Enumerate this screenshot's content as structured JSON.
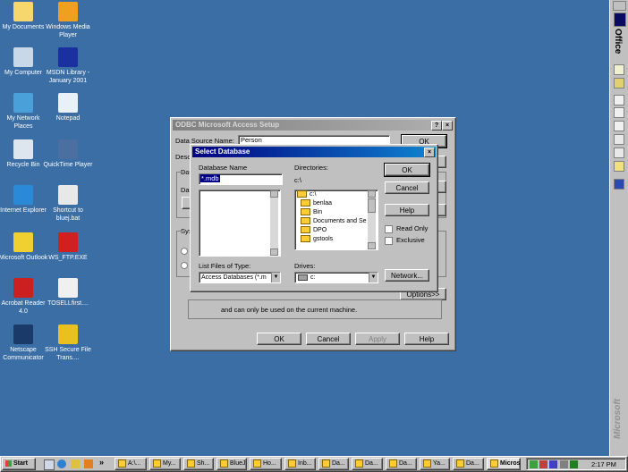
{
  "desktop_icons": [
    {
      "label": "My Documents",
      "icon": "folder-documents-icon",
      "color": "#f5d76e"
    },
    {
      "label": "Windows Media Player",
      "icon": "media-player-icon",
      "color": "#f0a020"
    },
    {
      "label": "My Computer",
      "icon": "computer-icon",
      "color": "#c8d8e8"
    },
    {
      "label": "MSDN Library - January 2001",
      "icon": "msdn-icon",
      "color": "#1a2fa0"
    },
    {
      "label": "My Network Places",
      "icon": "network-icon",
      "color": "#4aa0d8"
    },
    {
      "label": "Notepad",
      "icon": "notepad-icon",
      "color": "#e8f0f8"
    },
    {
      "label": "Recycle Bin",
      "icon": "recycle-bin-icon",
      "color": "#dde6ef"
    },
    {
      "label": "QuickTime Player",
      "icon": "quicktime-icon",
      "color": "#4a6fa0"
    },
    {
      "label": "Internet Explorer",
      "icon": "internet-explorer-icon",
      "color": "#2a8ad8"
    },
    {
      "label": "Shortcut to bluej.bat",
      "icon": "bat-shortcut-icon",
      "color": "#e8e8e8"
    },
    {
      "label": "Microsoft Outlook",
      "icon": "outlook-icon",
      "color": "#f0d030"
    },
    {
      "label": "WS_FTP.EXE",
      "icon": "ftp-icon",
      "color": "#d02020"
    },
    {
      "label": "Acrobat Reader 4.0",
      "icon": "acrobat-icon",
      "color": "#cc2020"
    },
    {
      "label": "TOSELLfirst....",
      "icon": "text-file-icon",
      "color": "#f0f0f0"
    },
    {
      "label": "Netscape Communicator",
      "icon": "netscape-icon",
      "color": "#1a3a6a"
    },
    {
      "label": "SSH Secure File Trans....",
      "icon": "ssh-icon",
      "color": "#e8c020"
    }
  ],
  "odbc": {
    "title": "ODBC Microsoft Access Setup",
    "help_btn": "?",
    "close_btn": "×",
    "dsn_label": "Data Source Name:",
    "dsn_value": "Person",
    "desc_label": "Desc",
    "db_label": "Dat",
    "db_label2": "Dat",
    "sys_label": "Syst",
    "ok_top": "OK",
    "hidden_text": "and can only be used on the current machine.",
    "options_btn": "Options>>",
    "ok": "OK",
    "cancel": "Cancel",
    "apply": "Apply",
    "help": "Help"
  },
  "select_db": {
    "title": "Select Database",
    "close_btn": "×",
    "dbname_label": "Database Name",
    "dbname_value": "*.mdb",
    "directories_label": "Directories:",
    "current_dir": "c:\\",
    "dirs": [
      "c:\\",
      "benlaa",
      "Bin",
      "Documents and Se",
      "DPO",
      "gstools"
    ],
    "filetype_label": "List Files of Type:",
    "filetype_value": "Access Databases (*.m",
    "drives_label": "Drives:",
    "drive_value": "c:",
    "ok": "OK",
    "cancel": "Cancel",
    "help": "Help",
    "read_only": "Read Only",
    "exclusive": "Exclusive",
    "network": "Network..."
  },
  "office_bar": {
    "title": "Office",
    "brand": "Microsoft"
  },
  "taskbar": {
    "start": "Start",
    "overflow": "»",
    "items": [
      "A:\\...",
      "My...",
      "Sh...",
      "BlueJ",
      "Ho...",
      "Inb...",
      "Da...",
      "Da...",
      "Da...",
      "Ya...",
      "Da...",
      "Micros..."
    ],
    "time": "2:17 PM"
  }
}
